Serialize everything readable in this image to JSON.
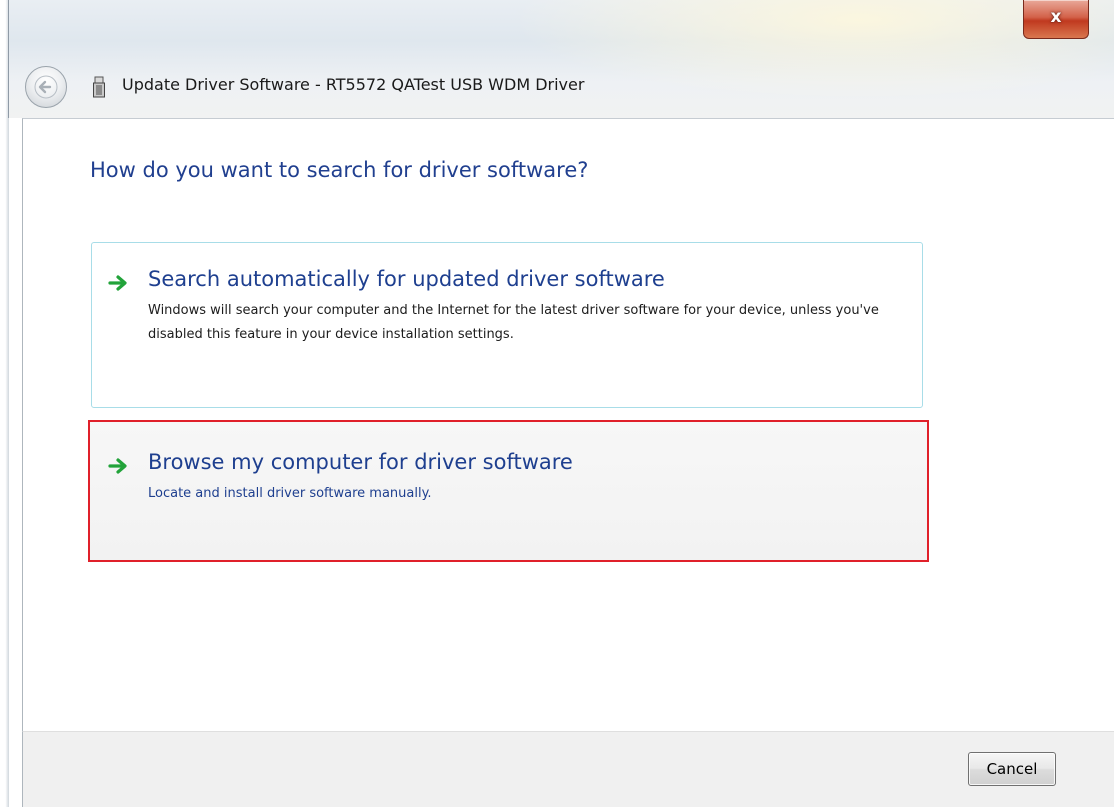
{
  "window": {
    "title": "Update Driver Software - RT5572 QATest USB WDM Driver",
    "close_label": "x",
    "icons": {
      "back": "back-arrow-icon",
      "device": "usb-device-icon",
      "option_arrow": "green-arrow-icon"
    }
  },
  "main": {
    "heading": "How do you want to search for driver software?",
    "options": [
      {
        "title": "Search automatically for updated driver software",
        "description": "Windows will search your computer and the Internet for the latest driver software for your device, unless you've disabled this feature in your device installation settings."
      },
      {
        "title": "Browse my computer for driver software",
        "description": "Locate and install driver software manually."
      }
    ]
  },
  "footer": {
    "cancel_label": "Cancel"
  },
  "colors": {
    "heading": "#203f8f",
    "highlight_border": "#e0202a",
    "option_border": "#a8dde8",
    "arrow": "#22a33a"
  }
}
